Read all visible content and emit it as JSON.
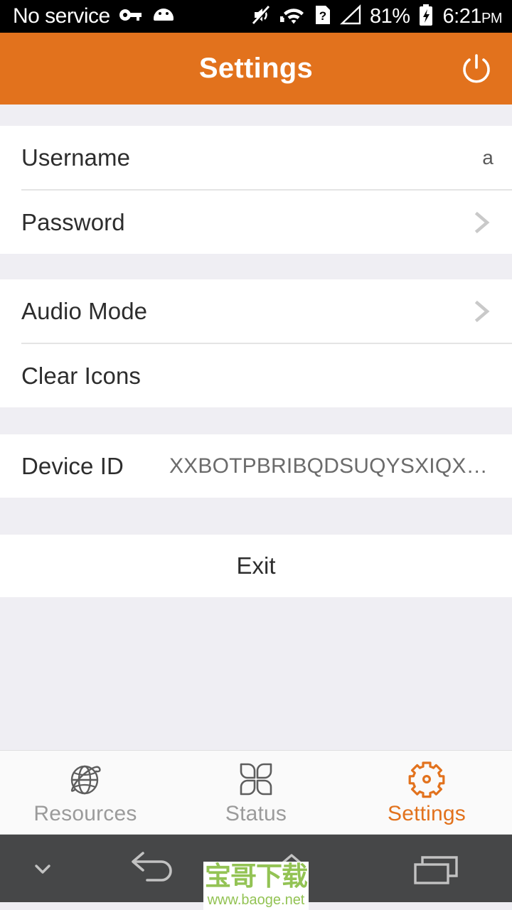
{
  "status_bar": {
    "carrier": "No service",
    "battery_percent": "81%",
    "time": "6:21",
    "meridiem": "PM",
    "icons": [
      "vpn-key-icon",
      "android-head-icon",
      "mute-icon",
      "wifi-icon",
      "sim-unknown-icon",
      "signal-icon",
      "battery-charging-icon"
    ]
  },
  "action_bar": {
    "title": "Settings",
    "power_icon": "power-icon"
  },
  "settings": {
    "groups": [
      {
        "rows": [
          {
            "label": "Username",
            "value": "a",
            "accessory": "none"
          },
          {
            "label": "Password",
            "value": "",
            "accessory": "chevron"
          }
        ]
      },
      {
        "rows": [
          {
            "label": "Audio Mode",
            "value": "",
            "accessory": "chevron"
          },
          {
            "label": "Clear Icons",
            "value": "",
            "accessory": "none"
          }
        ]
      },
      {
        "rows": [
          {
            "label": "Device ID",
            "value": "XXBOTPBRIBQDSUQYSXIQXTFPR…",
            "accessory": "none"
          }
        ]
      }
    ],
    "exit_label": "Exit"
  },
  "tab_bar": {
    "tabs": [
      {
        "label": "Resources",
        "icon": "globe-icon",
        "active": false
      },
      {
        "label": "Status",
        "icon": "clover-icon",
        "active": false
      },
      {
        "label": "Settings",
        "icon": "gear-icon",
        "active": true
      }
    ],
    "active_color": "#E2721D",
    "inactive_color": "#9B9B9B"
  },
  "nav_bar": {
    "buttons": [
      {
        "name": "hide-keyboard-button",
        "icon": "chevron-down-icon"
      },
      {
        "name": "back-button",
        "icon": "back-arrow-icon"
      },
      {
        "name": "home-button",
        "icon": "home-icon"
      },
      {
        "name": "recents-button",
        "icon": "recents-icon"
      }
    ]
  },
  "watermark": {
    "text_cn": "宝哥下载",
    "url": "www.baoge.net",
    "color": "#93C354"
  },
  "theme": {
    "accent": "#E2721D",
    "page_bg": "#EFEEF3",
    "card_bg": "#FFFFFF",
    "status_bar_bg": "#000000",
    "nav_bar_bg": "#464748"
  }
}
